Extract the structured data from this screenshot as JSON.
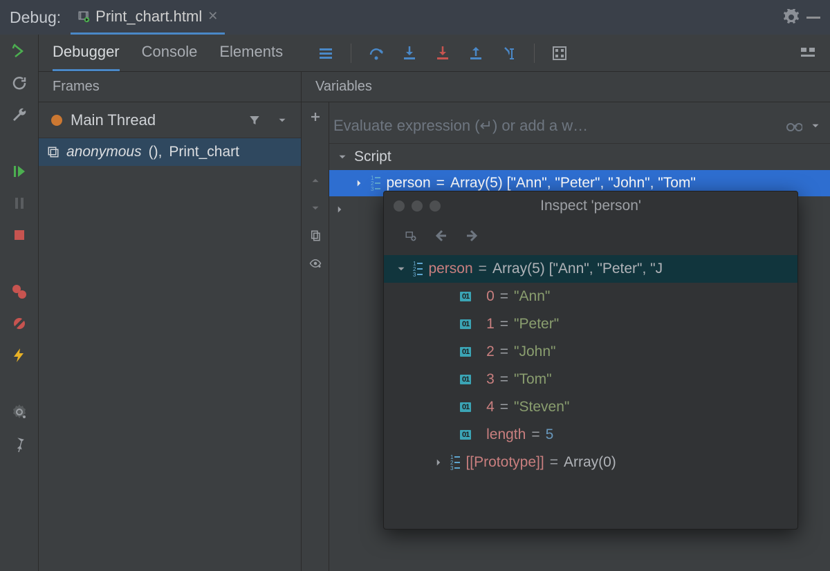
{
  "titlebar": {
    "title": "Debug:",
    "tab": "Print_chart.html"
  },
  "tabs": {
    "debugger": "Debugger",
    "console": "Console",
    "elements": "Elements"
  },
  "frames": {
    "header": "Frames",
    "thread": "Main Thread",
    "stack_fn": "anonymous",
    "stack_file": "Print_chart"
  },
  "variables": {
    "header": "Variables",
    "input_placeholder": "Evaluate expression (↵) or add a w…",
    "root": "Script",
    "person_label": "person",
    "person_value": "Array(5) [\"Ann\", \"Peter\", \"John\", \"Tom\""
  },
  "inspect": {
    "title": "Inspect 'person'",
    "root_label": "person",
    "root_value": "Array(5) [\"Ann\", \"Peter\", \"J",
    "items": [
      {
        "idx": "0",
        "val": "\"Ann\""
      },
      {
        "idx": "1",
        "val": "\"Peter\""
      },
      {
        "idx": "2",
        "val": "\"John\""
      },
      {
        "idx": "3",
        "val": "\"Tom\""
      },
      {
        "idx": "4",
        "val": "\"Steven\""
      }
    ],
    "length_label": "length",
    "length_value": "5",
    "proto_label": "[[Prototype]]",
    "proto_value": "Array(0)"
  }
}
